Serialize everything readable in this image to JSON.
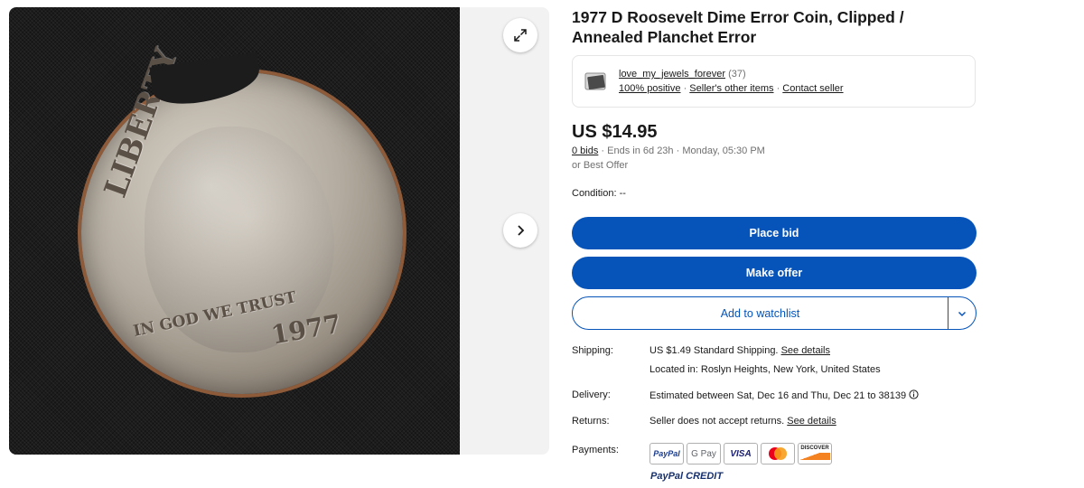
{
  "listing": {
    "title": "1977 D Roosevelt Dime Error Coin, Clipped / Annealed Planchet Error",
    "image_alt": "Clipped 1977 D Roosevelt dime on black cloth",
    "coin_text": {
      "liberty": "LIBERTY",
      "motto": "IN GOD WE TRUST",
      "year": "1977"
    }
  },
  "seller": {
    "name": "love_my_jewels_forever",
    "feedback_count": "(37)",
    "positive": "100% positive",
    "other_items": "Seller's other items",
    "contact": "Contact seller"
  },
  "price": "US $14.95",
  "bids": {
    "count": "0 bids",
    "ends": "Ends in 6d 23h · Monday, 05:30 PM",
    "best_offer": "or Best Offer"
  },
  "condition": {
    "label": "Condition:",
    "value": "--"
  },
  "buttons": {
    "place_bid": "Place bid",
    "make_offer": "Make offer",
    "watchlist": "Add to watchlist"
  },
  "details": {
    "shipping_label": "Shipping:",
    "shipping_value": "US $1.49 Standard Shipping.",
    "shipping_link": "See details",
    "location": "Located in: Roslyn Heights, New York, United States",
    "delivery_label": "Delivery:",
    "delivery_value": "Estimated between Sat, Dec 16 and Thu, Dec 21 to 38139",
    "returns_label": "Returns:",
    "returns_value": "Seller does not accept returns.",
    "returns_link": "See details",
    "payments_label": "Payments:"
  },
  "payments": {
    "methods": [
      "PayPal",
      "G Pay",
      "VISA",
      "Mastercard",
      "DISCOVER"
    ],
    "paypal_credit": "PayPal CREDIT"
  },
  "colors": {
    "primary": "#0654ba",
    "text": "#191919",
    "muted": "#707070"
  }
}
